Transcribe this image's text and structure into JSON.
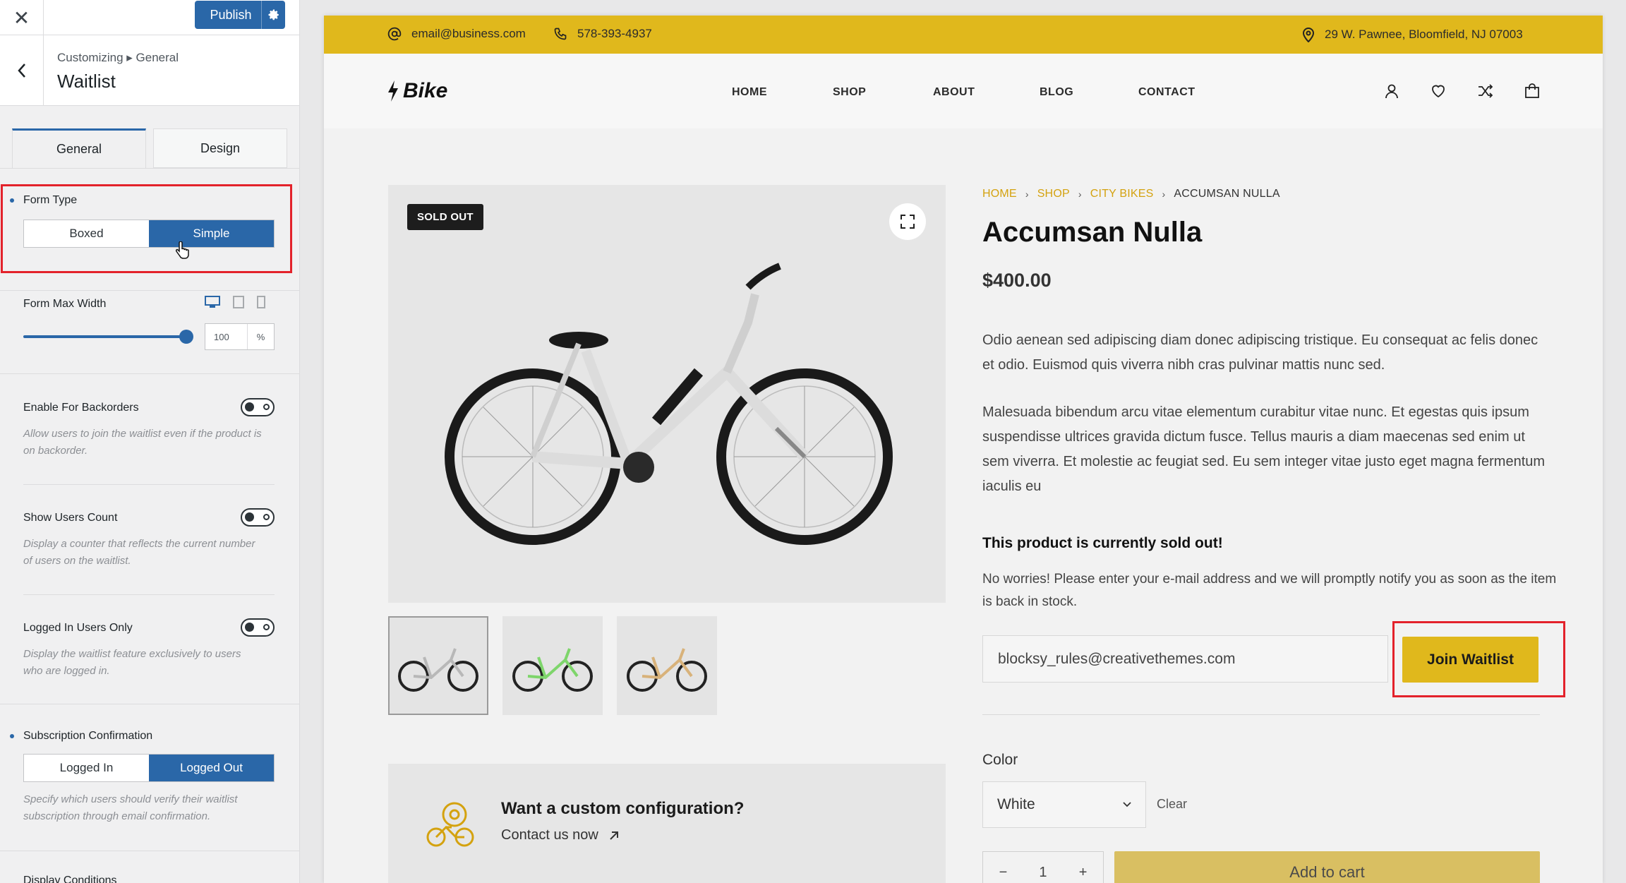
{
  "customizer": {
    "close_glyph": "✕",
    "publish_label": "Publish",
    "breadcrumb": "Customizing ▸ General",
    "title": "Waitlist",
    "tabs": [
      {
        "label": "General"
      },
      {
        "label": "Design"
      }
    ],
    "form_type": {
      "label": "Form Type",
      "options": [
        "Boxed",
        "Simple"
      ],
      "selected": "Simple"
    },
    "form_max_width": {
      "label": "Form Max Width",
      "value": "100",
      "unit": "%",
      "devices": [
        "desktop-icon",
        "tablet-icon",
        "mobile-icon"
      ]
    },
    "enable_backorders": {
      "label": "Enable For Backorders",
      "desc": "Allow users to join the waitlist even if the product is on backorder."
    },
    "show_users_count": {
      "label": "Show Users Count",
      "desc": "Display a counter that reflects the current number of users on the waitlist."
    },
    "logged_in_only": {
      "label": "Logged In Users Only",
      "desc": "Display the waitlist feature exclusively to users who are logged in."
    },
    "subscription_confirmation": {
      "label": "Subscription Confirmation",
      "options": [
        "Logged In",
        "Logged Out"
      ],
      "selected": "Logged Out",
      "desc": "Specify which users should verify their waitlist subscription through email confirmation."
    },
    "display_conditions": {
      "label": "Display Conditions"
    }
  },
  "site": {
    "topbar": {
      "email": "email@business.com",
      "phone": "578-393-4937",
      "address": "29 W. Pawnee, Bloomfield, NJ 07003"
    },
    "logo": "Bike",
    "nav": [
      "HOME",
      "SHOP",
      "ABOUT",
      "BLOG",
      "CONTACT"
    ],
    "header_icons": [
      "user-icon",
      "heart-icon",
      "shuffle-icon",
      "bag-icon"
    ],
    "product": {
      "badge": "SOLD OUT",
      "breadcrumb": [
        "HOME",
        "SHOP",
        "CITY BIKES",
        "ACCUMSAN NULLA"
      ],
      "title": "Accumsan Nulla",
      "price": "$400.00",
      "desc1": "Odio aenean sed adipiscing diam donec adipiscing tristique. Eu consequat ac felis donec et odio. Euismod quis viverra nibh cras pulvinar mattis nunc sed.",
      "desc2": "Malesuada bibendum arcu vitae elementum curabitur vitae nunc. Et egestas quis ipsum suspendisse ultrices gravida dictum fusce. Tellus mauris a diam maecenas sed enim ut sem viverra. Et molestie ac feugiat sed. Eu sem integer vitae justo eget magna fermentum iaculis eu",
      "sold_heading": "This product is currently sold out!",
      "notify_text": "No worries! Please enter your e-mail address and we will promptly notify you as soon as the item is back in stock.",
      "email_value": "blocksy_rules@creativethemes.com",
      "join_label": "Join Waitlist",
      "color_label": "Color",
      "color_value": "White",
      "clear_label": "Clear",
      "qty_minus": "−",
      "qty_value": "1",
      "qty_plus": "+",
      "add_to_cart": "Add to cart",
      "thumb_colors": [
        "#b8b8b8",
        "#7ed56b",
        "#d8b27a"
      ],
      "custom_title": "Want a custom configuration?",
      "custom_link": "Contact us now"
    }
  },
  "colors": {
    "accent": "#e0b81c",
    "admin_blue": "#2a67a8",
    "highlight_red": "#e3222b"
  }
}
